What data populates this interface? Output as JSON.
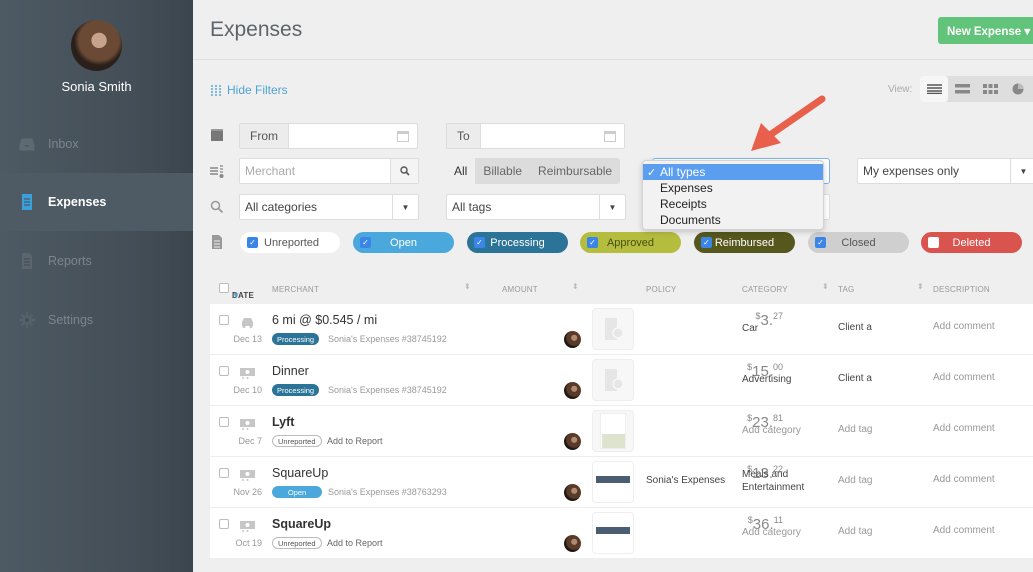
{
  "sidebar": {
    "user_name": "Sonia Smith",
    "items": [
      {
        "label": "Inbox",
        "icon": "inbox-icon",
        "active": false
      },
      {
        "label": "Expenses",
        "icon": "receipt-icon",
        "active": true
      },
      {
        "label": "Reports",
        "icon": "document-icon",
        "active": false
      },
      {
        "label": "Settings",
        "icon": "gear-icon",
        "active": false
      }
    ]
  },
  "header": {
    "title": "Expenses",
    "new_expense_label": "New Expense ▾"
  },
  "toolbar": {
    "hide_filters_label": "Hide Filters",
    "view_label": "View:",
    "view_modes": [
      "list",
      "compact",
      "grid",
      "chart"
    ]
  },
  "filters": {
    "from_label": "From",
    "to_label": "To",
    "merchant_placeholder": "Merchant",
    "billable_options": [
      "All",
      "Billable",
      "Reimbursable"
    ],
    "billable_selected": "All",
    "categories_value": "All categories",
    "tags_value": "All tags",
    "types_dropdown": {
      "options": [
        "All types",
        "Expenses",
        "Receipts",
        "Documents"
      ],
      "selected": "All types",
      "check": "✓"
    },
    "owner_value": "My expenses only",
    "statuses": [
      {
        "label": "Unreported",
        "checked": true,
        "color": "#ffffff",
        "text_color": "#555555"
      },
      {
        "label": "Open",
        "checked": true,
        "color": "#4aa8dc",
        "text_color": "#ffffff"
      },
      {
        "label": "Processing",
        "checked": true,
        "color": "#2b7498",
        "text_color": "#ffffff"
      },
      {
        "label": "Approved",
        "checked": true,
        "color": "#b5bd3f",
        "text_color": "#4a4f10"
      },
      {
        "label": "Reimbursed",
        "checked": true,
        "color": "#56571d",
        "text_color": "#ffffff"
      },
      {
        "label": "Closed",
        "checked": true,
        "color": "#cfcfcf",
        "text_color": "#555555"
      },
      {
        "label": "Deleted",
        "checked": false,
        "color": "#d9534f",
        "text_color": "#ffffff"
      }
    ]
  },
  "table": {
    "columns": [
      "DATE",
      "MERCHANT",
      "AMOUNT",
      "POLICY",
      "CATEGORY",
      "TAG",
      "DESCRIPTION"
    ],
    "rows": [
      {
        "date": "Dec 13",
        "type_icon": "car-icon",
        "merchant": "6 mi @ $0.545 / mi",
        "bold": false,
        "status": "Processing",
        "report": "Sonia's Expenses #38745192",
        "amount_whole": "3",
        "amount_cents": "27",
        "receipt": "missing",
        "policy": "",
        "category": "Car",
        "category_muted": false,
        "tag": "Client a",
        "tag_muted": false,
        "description": "Add comment"
      },
      {
        "date": "Dec 10",
        "type_icon": "cash-icon",
        "merchant": "Dinner",
        "bold": false,
        "status": "Processing",
        "report": "Sonia's Expenses #38745192",
        "amount_whole": "15",
        "amount_cents": "00",
        "receipt": "missing",
        "policy": "",
        "category": "Advertising",
        "category_muted": false,
        "tag": "Client a",
        "tag_muted": false,
        "description": "Add comment"
      },
      {
        "date": "Dec 7",
        "type_icon": "cash-icon",
        "merchant": "Lyft",
        "bold": true,
        "status": "Unreported",
        "report": "Add to Report",
        "amount_whole": "23",
        "amount_cents": "81",
        "receipt": "map",
        "policy": "",
        "category": "Add category",
        "category_muted": true,
        "tag": "Add tag",
        "tag_muted": true,
        "description": "Add comment"
      },
      {
        "date": "Nov 26",
        "type_icon": "cash-icon",
        "merchant": "SquareUp",
        "bold": false,
        "status": "Open",
        "report": "Sonia's Expenses #38763293",
        "amount_whole": "13",
        "amount_cents": "22",
        "receipt": "invoice",
        "policy": "Sonia's Expenses",
        "category": "Meals and Entertainment",
        "category_muted": false,
        "tag": "Add tag",
        "tag_muted": true,
        "description": "Add comment"
      },
      {
        "date": "Oct 19",
        "type_icon": "cash-icon",
        "merchant": "SquareUp",
        "bold": true,
        "status": "Unreported",
        "report": "Add to Report",
        "amount_whole": "36",
        "amount_cents": "11",
        "receipt": "invoice",
        "policy": "",
        "category": "Add category",
        "category_muted": true,
        "tag": "Add tag",
        "tag_muted": true,
        "description": "Add comment"
      }
    ],
    "currency": "$"
  },
  "colors": {
    "accent": "#4da3d4",
    "new_button": "#62c47a",
    "annotation_arrow": "#e8604c"
  }
}
